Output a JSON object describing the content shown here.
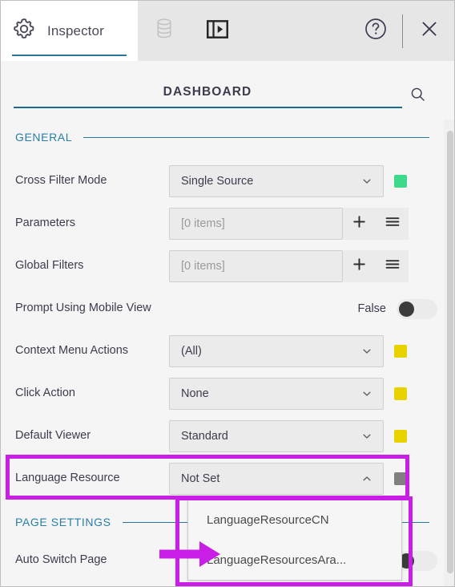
{
  "toolbar": {
    "tab_label": "Inspector",
    "icons": {
      "gear": "gear-icon",
      "database": "database-icon",
      "panel": "panel-split-icon",
      "help": "help-circle-icon",
      "close": "close-icon"
    }
  },
  "header": {
    "title": "DASHBOARD",
    "search_icon": "search-icon"
  },
  "sections": [
    {
      "id": "general",
      "label": "GENERAL"
    },
    {
      "id": "page_settings",
      "label": "PAGE SETTINGS"
    }
  ],
  "properties": [
    {
      "label": "Cross Filter Mode",
      "control": "select",
      "value": "Single Source",
      "chevron": "chevron-down-icon",
      "swatch": "#3ed98a"
    },
    {
      "label": "Parameters",
      "control": "collection",
      "value": "[0 items]",
      "is_placeholder": true,
      "add_label": "+",
      "menu_icon": "hamburger-icon"
    },
    {
      "label": "Global Filters",
      "control": "collection",
      "value": "[0 items]",
      "is_placeholder": true,
      "add_label": "+",
      "menu_icon": "hamburger-icon"
    },
    {
      "label": "Prompt Using Mobile View",
      "control": "toggle",
      "value": "False",
      "toggle_on": false
    },
    {
      "label": "Context Menu Actions",
      "control": "select",
      "value": "(All)",
      "chevron": "chevron-down-icon",
      "swatch": "#e8d200"
    },
    {
      "label": "Click Action",
      "control": "select",
      "value": "None",
      "chevron": "chevron-down-icon",
      "swatch": "#e8d200"
    },
    {
      "label": "Default Viewer",
      "control": "select",
      "value": "Standard",
      "chevron": "chevron-down-icon",
      "swatch": "#e8d200"
    },
    {
      "label": "Language Resource",
      "control": "select",
      "value": "Not Set",
      "chevron": "chevron-up-icon",
      "swatch": "#808080",
      "expanded": true,
      "highlighted": true
    }
  ],
  "page_settings_properties": [
    {
      "label": "Auto Switch Page",
      "control": "toggle",
      "toggle_on": false
    }
  ],
  "dropdown": {
    "open": true,
    "options": [
      {
        "label": "LanguageResourceCN",
        "highlighted": false
      },
      {
        "label": "LanguageResourcesAra...",
        "highlighted": true
      }
    ]
  },
  "annotation": {
    "color": "#c81ee6",
    "arrow_target": "LanguageResourcesAra..."
  },
  "colors": {
    "accent_blue": "#2a7699",
    "section_label": "#2a7ea6",
    "panel_bg": "#f5f5f5",
    "toolbar_bg": "#e6e6e6",
    "field_bg": "#ebebeb",
    "text": "#3c3c4e"
  }
}
